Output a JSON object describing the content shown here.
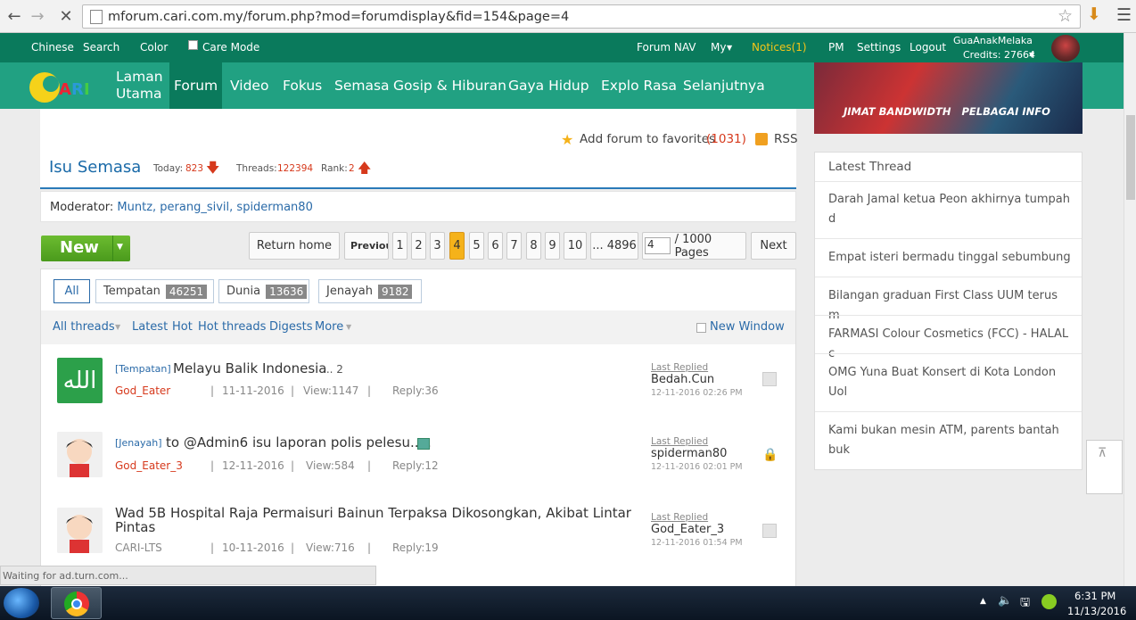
{
  "browser": {
    "url": "mforum.cari.com.my/forum.php?mod=forumdisplay&fid=154&page=4",
    "status_text": "Waiting for ad.turn.com..."
  },
  "topbar": {
    "chinese": "Chinese",
    "search": "Search",
    "color": "Color",
    "care_mode": "Care Mode",
    "forum_nav": "Forum NAV",
    "my": "My",
    "notices": "Notices(1)",
    "pm": "PM",
    "settings": "Settings",
    "logout": "Logout",
    "username": "GuaAnakMelaka",
    "credits": "Credits: 27664"
  },
  "mainnav": {
    "logo": "CARI",
    "items": [
      "Laman Utama",
      "Forum",
      "Video",
      "Fokus",
      "Semasa",
      "Gosip & Hiburan",
      "Gaya Hidup",
      "Explo Rasa",
      "Selanjutnya"
    ],
    "laman_1": "Laman",
    "laman_2": "Utama"
  },
  "banner": {
    "text": "JIMAT BANDWIDTH   PELBAGAI INFO"
  },
  "forum": {
    "favorites_label": "Add forum to favorites",
    "favorites_count": "(1031)",
    "rss": "RSS",
    "title": "Isu Semasa",
    "today_label": "Today:",
    "today_value": "823",
    "threads_label": "Threads:",
    "threads_value": "122394",
    "rank_label": "Rank:",
    "rank_value": "2",
    "moderator_label": "Moderator:",
    "moderators": "Muntz, perang_sivil, spiderman80"
  },
  "pager": {
    "new_label": "New",
    "return_home": "Return home",
    "previous": "Previous",
    "pages": [
      "1",
      "2",
      "3",
      "4",
      "5",
      "6",
      "7",
      "8",
      "9",
      "10",
      "... 4896"
    ],
    "current": "4",
    "page_input": "4",
    "total_pages": "/ 1000 Pages",
    "next": "Next"
  },
  "tabs": [
    {
      "label": "All",
      "count": ""
    },
    {
      "label": "Tempatan",
      "count": "46251"
    },
    {
      "label": "Dunia",
      "count": "13636"
    },
    {
      "label": "Jenayah",
      "count": "9182"
    }
  ],
  "filters": {
    "all_threads": "All threads",
    "latest": "Latest",
    "hot": "Hot",
    "hot_threads": "Hot threads",
    "digests": "Digests",
    "more": "More",
    "new_window": "New Window"
  },
  "threads": [
    {
      "tag": "[Tempatan]",
      "title": "Melayu Balik Indonesia",
      "extra": "... 2",
      "author": "God_Eater",
      "date": "11-11-2016",
      "views": "View:1147",
      "replies": "Reply:36",
      "last_replied_label": "Last Replied",
      "last_user": "Bedah.Cun",
      "last_date": "12-11-2016 02:26 PM"
    },
    {
      "tag": "[Jenayah]",
      "title": "to @Admin6 isu laporan polis pelesu.....",
      "extra": "",
      "author": "God_Eater_3",
      "date": "12-11-2016",
      "views": "View:584",
      "replies": "Reply:12",
      "last_replied_label": "Last Replied",
      "last_user": "spiderman80",
      "last_date": "12-11-2016 02:01 PM"
    },
    {
      "tag": "",
      "title_1": "Wad 5B Hospital Raja Permaisuri Bainun Terpaksa Dikosongkan, Akibat Lintar",
      "title_2": "Pintas",
      "author": "CARI-LTS",
      "date": "10-11-2016",
      "views": "View:716",
      "replies": "Reply:19",
      "last_replied_label": "Last Replied",
      "last_user": "God_Eater_3",
      "last_date": "12-11-2016 01:54 PM"
    }
  ],
  "latest_thread": {
    "header": "Latest Thread",
    "items": [
      {
        "l1": "Darah Jamal ketua Peon akhirnya tumpah",
        "l2": "d"
      },
      {
        "l1": "Empat isteri bermadu tinggal sebumbung",
        "l2": ""
      },
      {
        "l1": "Bilangan graduan First Class UUM terus m",
        "l2": ""
      },
      {
        "l1": "FARMASI Colour Cosmetics (FCC) - HALAL c",
        "l2": ""
      },
      {
        "l1": "OMG Yuna Buat Konsert di Kota London",
        "l2": "Uol"
      },
      {
        "l1": "Kami bukan mesin ATM, parents bantah",
        "l2": "buk"
      }
    ]
  },
  "taskbar": {
    "time": "6:31 PM",
    "date": "11/13/2016"
  },
  "colors": {
    "teal_dark": "#0a7a5c",
    "teal": "#21a182",
    "notice": "#f5c518",
    "red": "#d6391c",
    "link": "#2a6aa8",
    "new_green": "#5aa828"
  }
}
